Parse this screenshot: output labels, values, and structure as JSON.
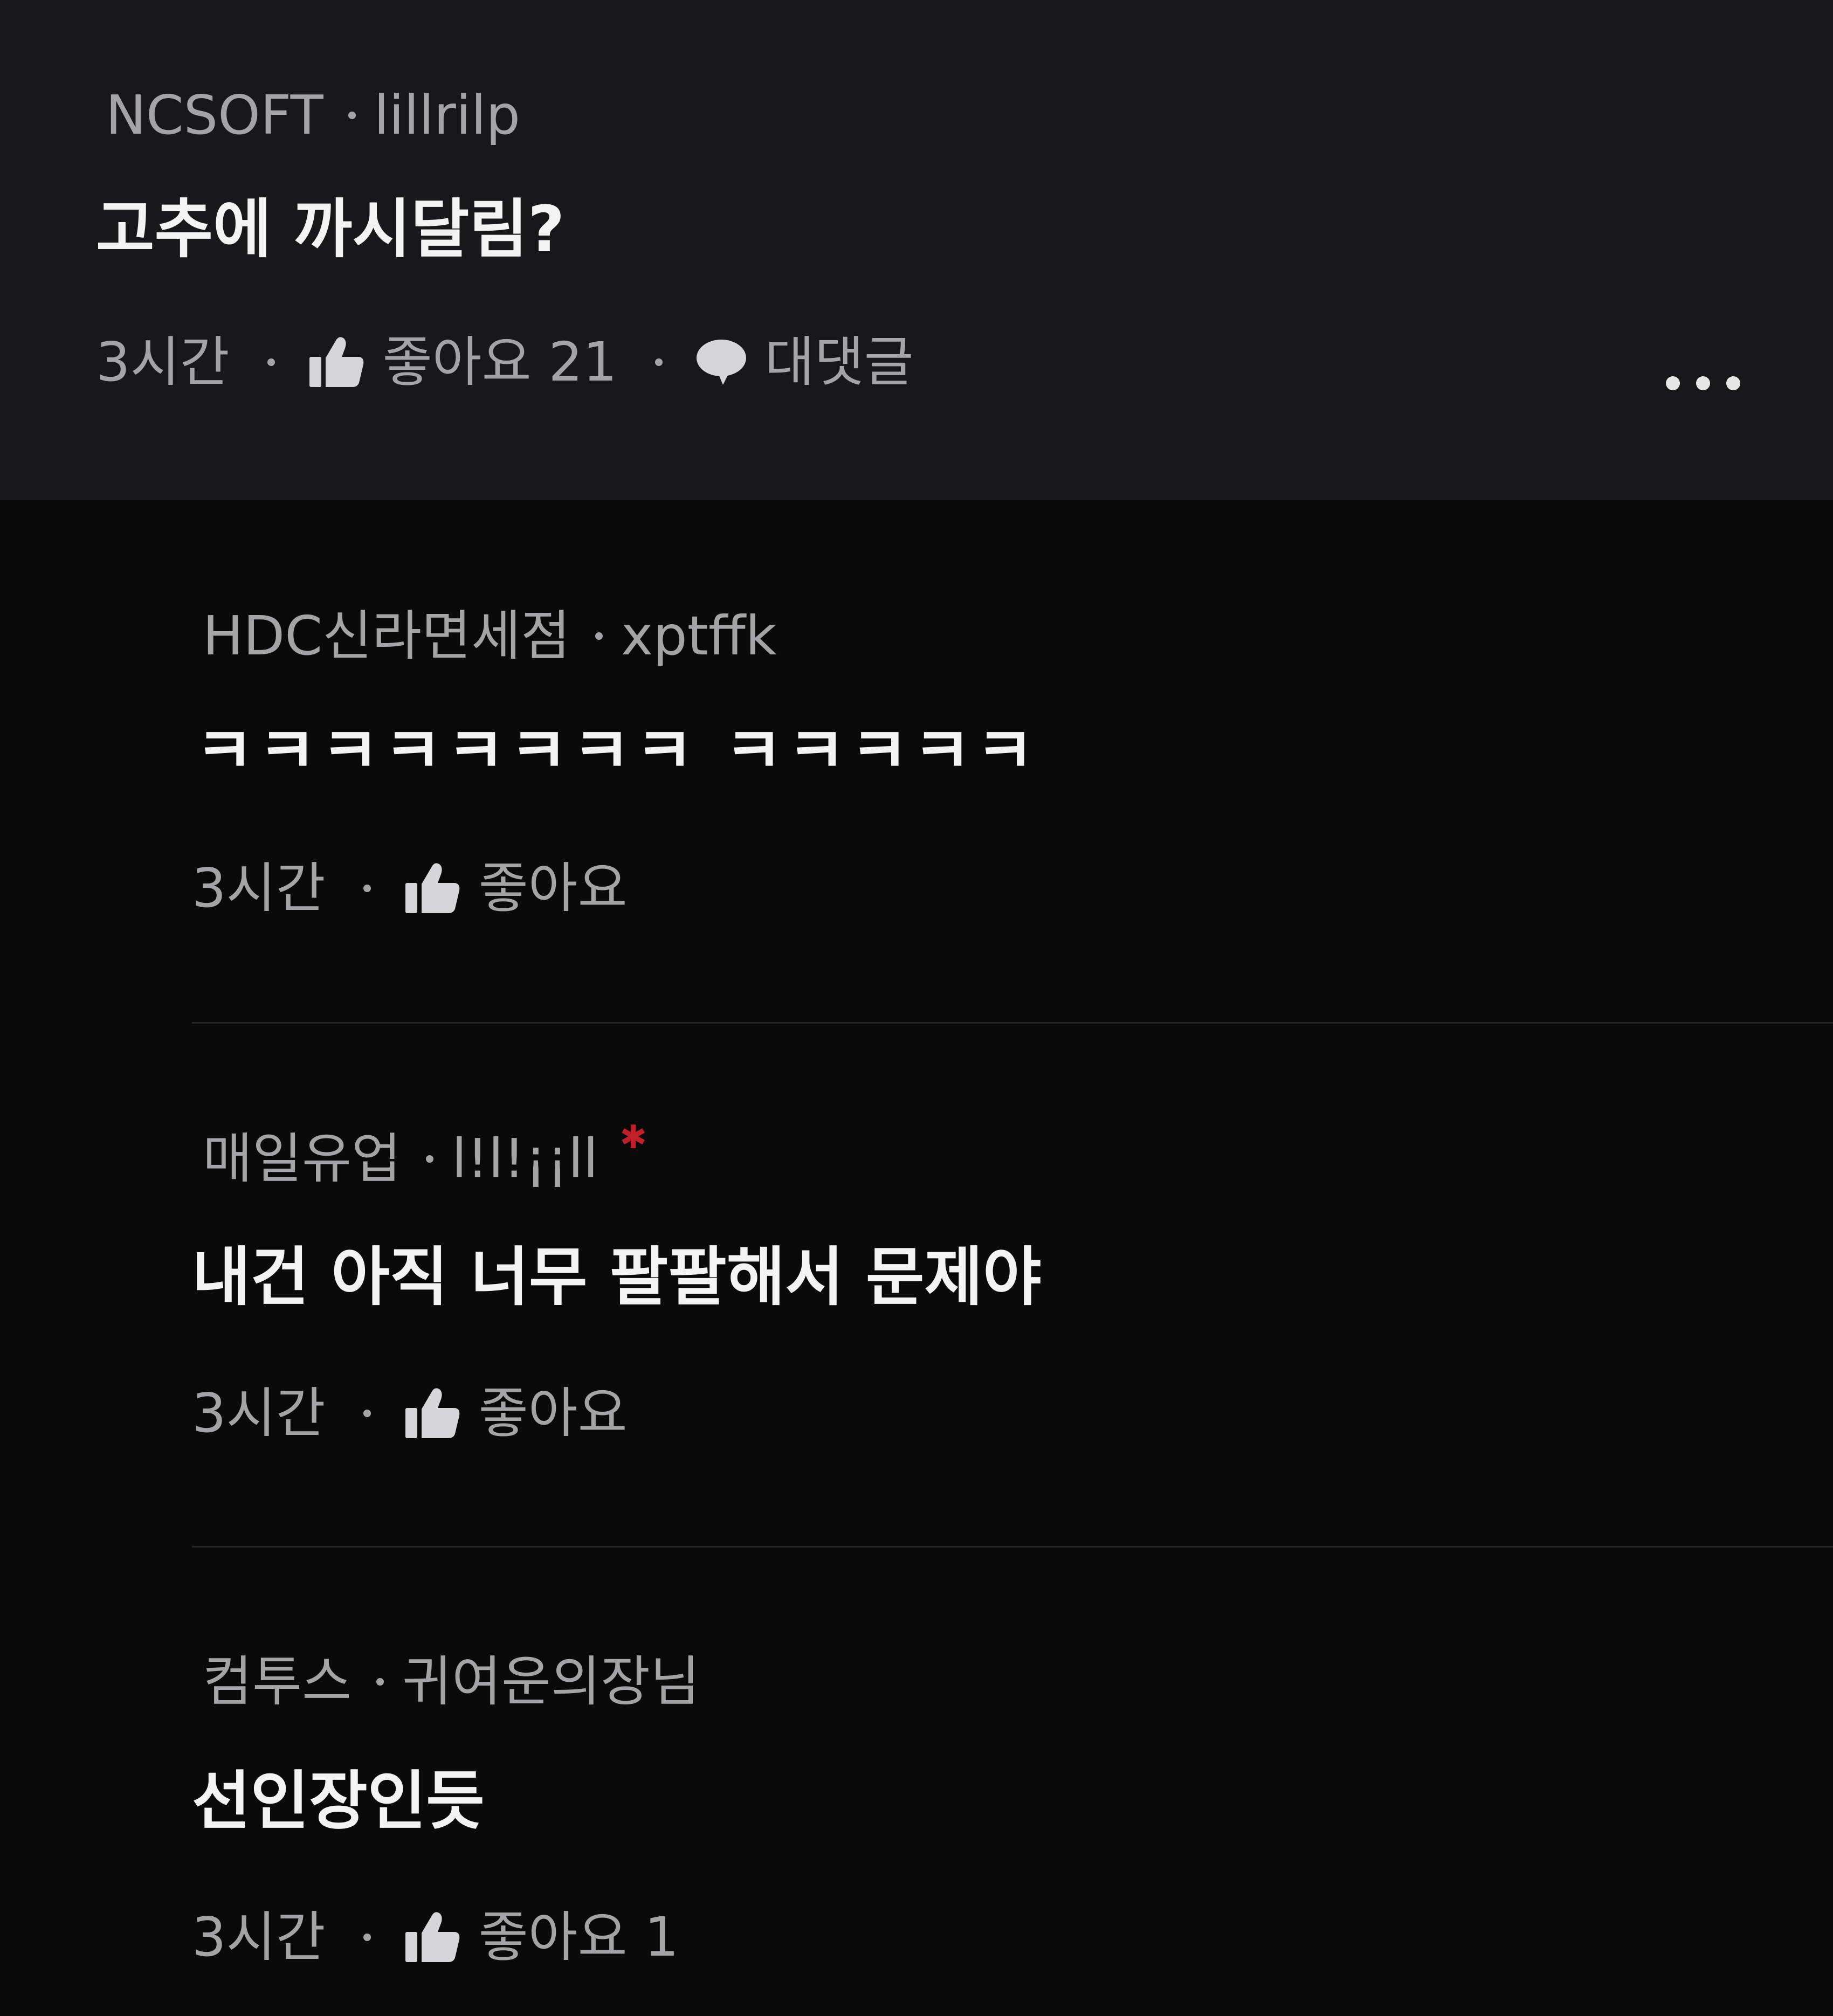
{
  "comments": [
    {
      "company": "NCSOFT",
      "user": "lillrilp",
      "text": "고추에 까시달림?",
      "time": "3시간",
      "like_label": "좋아요 21",
      "reply_label": "대댓글"
    },
    {
      "company": "HDC신라면세점",
      "user": "xptffk",
      "text": "ㅋㅋㅋㅋㅋㅋㅋㅋ ㅋㅋㅋㅋㅋ",
      "time": "3시간",
      "like_label": "좋아요"
    },
    {
      "company": "매일유업",
      "user": "l!l!¡¡ll",
      "text": "내건 아직 너무 팔팔해서 문제야",
      "time": "3시간",
      "like_label": "좋아요"
    },
    {
      "company": "컴투스",
      "user": "귀여운의장님",
      "text": "선인장인듯",
      "time": "3시간",
      "like_label": "좋아요 1"
    }
  ],
  "icons": {
    "like": "thumbs-up-icon",
    "reply": "speech-bubble-icon",
    "more": "more-dots-icon",
    "mark": "red-asterisk-icon"
  },
  "colors": {
    "background": "#0a0a0b",
    "top_comment_background": "#18181a",
    "meta_text": "#a4a4a6",
    "body_text": "#f3f3f3",
    "mark": "#c0202a"
  }
}
